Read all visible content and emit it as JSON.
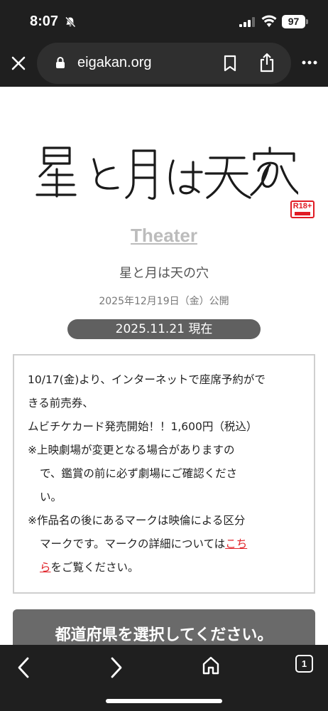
{
  "status_bar": {
    "time": "8:07",
    "battery": "97"
  },
  "browser": {
    "url": "eigakan.org",
    "tab_count": "1"
  },
  "page": {
    "logo_text": "星と月は天の穴",
    "rating_badge": "R18+",
    "theater_link": "Theater",
    "film_title": "星と月は天の穴",
    "release_date": "2025年12月19日（金）公開",
    "as_of": "2025.11.21 現在",
    "notice": {
      "line1": "10/17(金)より、インターネットで座席予約がで",
      "line2": "きる前売券、",
      "line3": "ムビチケカード発売開始！！1,600円（税込）",
      "line4": "※上映劇場が変更となる場合がありますの",
      "line5": "で、鑑賞の前に必ず劇場にご確認くださ",
      "line6": "い。",
      "line7": "※作品名の後にあるマークは映倫による区分",
      "line8_prefix": "マークです。マークの詳細については",
      "link_part1": "こち",
      "link_part2": "ら",
      "line9_suffix": "をご覧ください。"
    },
    "prefecture_button": "都道府県を選択してください。"
  },
  "colors": {
    "chrome_bg": "#1f1f1f",
    "link_red": "#e0242a",
    "pill_gray": "#606060"
  },
  "icons": [
    "bell-slash-icon",
    "signal-icon",
    "wifi-icon",
    "close-icon",
    "lock-icon",
    "bookmark-icon",
    "share-icon",
    "more-icon",
    "back-icon",
    "forward-icon",
    "home-icon",
    "tabs-icon"
  ]
}
